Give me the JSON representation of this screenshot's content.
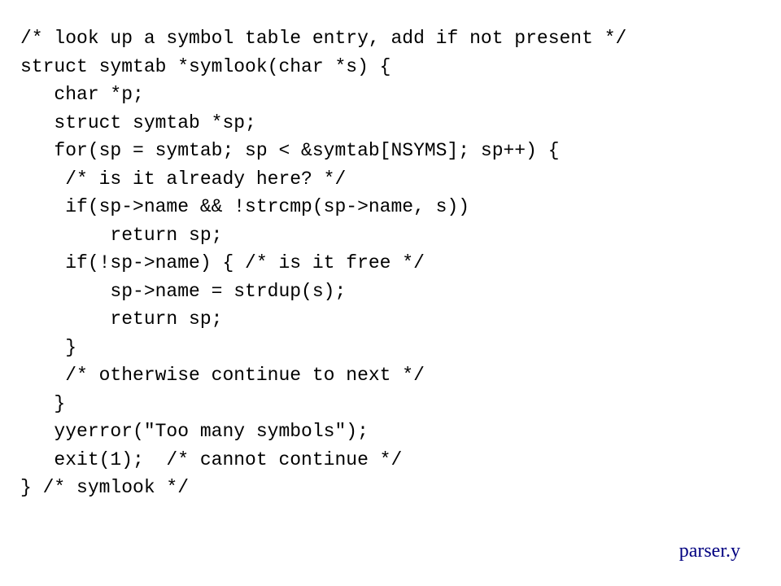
{
  "code": {
    "lines": [
      "/* look up a symbol table entry, add if not present */",
      "struct symtab *symlook(char *s) {",
      "   char *p;",
      "   struct symtab *sp;",
      "   for(sp = symtab; sp < &symtab[NSYMS]; sp++) {",
      "    /* is it already here? */",
      "    if(sp->name && !strcmp(sp->name, s))",
      "        return sp;",
      "    if(!sp->name) { /* is it free */",
      "        sp->name = strdup(s);",
      "        return sp;",
      "    }",
      "    /* otherwise continue to next */",
      "   }",
      "   yyerror(\"Too many symbols\");",
      "   exit(1);  /* cannot continue */",
      "} /* symlook */"
    ]
  },
  "filename": "parser.y"
}
